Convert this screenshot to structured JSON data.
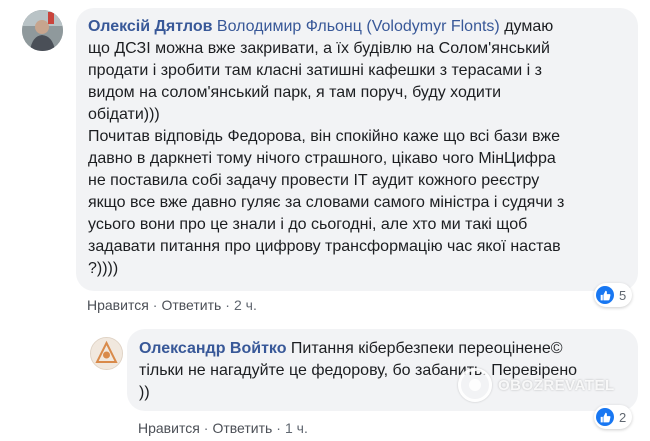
{
  "comment1": {
    "author": "Олексій Дятлов",
    "mention": "Володимир Фльонц (Volodymyr Flonts)",
    "lines": [
      " думаю",
      "що ДСЗІ можна вже закривати, а їх будівлю на Солом'янський",
      "продати і зробити там класні затишні кафешки з терасами і з",
      "видом на солом'янський парк, я там поруч, буду ходити",
      "обідати)))",
      "Почитав відповідь Федорова, він спокійно каже що всі бази вже",
      "давно в даркнеті тому нічого страшного, цікаво чого МінЦифра",
      "не поставила собі задачу провести IT аудит кожного реєстру",
      "якщо все вже давно гуляє за словами самого міністра і судячи з",
      "усього вони про це знали і до сьогодні, але хто ми такі щоб",
      "задавати питання про цифрову трансформацію час якої настав",
      "?))))"
    ],
    "like_label": "Нравится",
    "reply_label": "Ответить",
    "time": "2 ч.",
    "reaction_count": "5",
    "reaction_icon": "thumbs-up-icon"
  },
  "comment2": {
    "author": "Олександр Войтко",
    "lines": [
      " Питання кібербезпеки переоцінене©",
      "тільки не нагадуйте це федорову, бо забанить. Перевірено",
      "))"
    ],
    "like_label": "Нравится",
    "reply_label": "Ответить",
    "time": "1 ч.",
    "reaction_count": "2",
    "reaction_icon": "thumbs-up-icon"
  },
  "watermark": {
    "text": "OBOZREVATEL"
  },
  "separator": "·",
  "colors": {
    "link": "#385898",
    "bubble": "#f2f3f5",
    "like_blue": "#1877f2",
    "meta": "#606770"
  }
}
